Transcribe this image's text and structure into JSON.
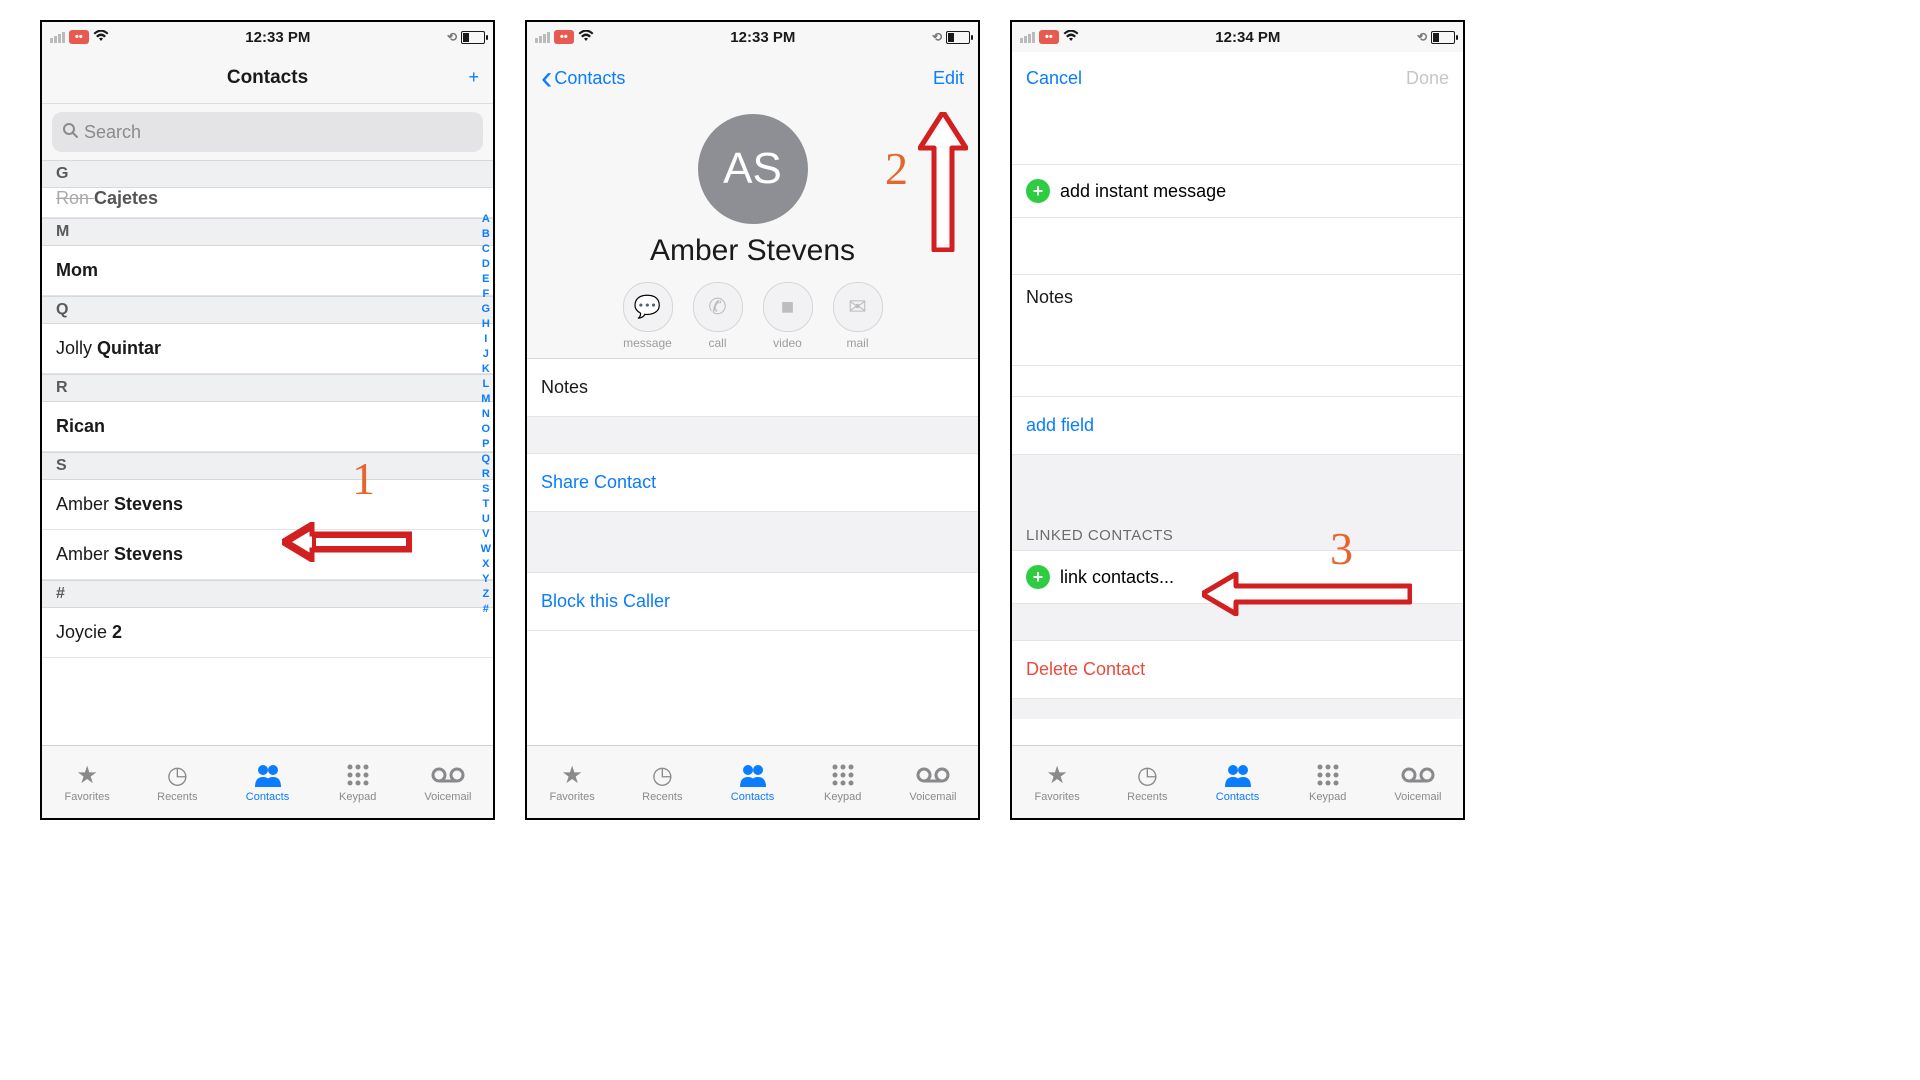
{
  "screen1": {
    "status_time": "12:33 PM",
    "carrier_badge": "••",
    "title": "Contacts",
    "search_placeholder": "Search",
    "cut_contact": "Ron Cajetes",
    "sections": {
      "G": "G",
      "M": "M",
      "Q": "Q",
      "R": "R",
      "S": "S",
      "hash": "#"
    },
    "mom": "Mom",
    "jolly_first": "Jolly ",
    "jolly_last": "Quintar",
    "rican": "Rican",
    "amber_first": "Amber ",
    "amber_last": "Stevens",
    "joycie_first": "Joycie ",
    "joycie_last": "2",
    "index": [
      "A",
      "B",
      "C",
      "D",
      "E",
      "F",
      "G",
      "H",
      "I",
      "J",
      "K",
      "L",
      "M",
      "N",
      "O",
      "P",
      "Q",
      "R",
      "S",
      "T",
      "U",
      "V",
      "W",
      "X",
      "Y",
      "Z",
      "#"
    ],
    "annotation_number": "1"
  },
  "screen2": {
    "status_time": "12:33 PM",
    "back_label": "Contacts",
    "edit_label": "Edit",
    "initials": "AS",
    "full_name": "Amber Stevens",
    "actions": {
      "message": "message",
      "call": "call",
      "video": "video",
      "mail": "mail"
    },
    "notes_label": "Notes",
    "share_label": "Share Contact",
    "block_label": "Block this Caller",
    "annotation_number": "2"
  },
  "screen3": {
    "status_time": "12:34 PM",
    "cancel_label": "Cancel",
    "done_label": "Done",
    "add_im_label": "add instant message",
    "notes_label": "Notes",
    "add_field_label": "add field",
    "linked_header": "LINKED CONTACTS",
    "link_contacts_label": "link contacts...",
    "delete_label": "Delete Contact",
    "annotation_number": "3"
  },
  "tabs": {
    "favorites": "Favorites",
    "recents": "Recents",
    "contacts": "Contacts",
    "keypad": "Keypad",
    "voicemail": "Voicemail"
  }
}
